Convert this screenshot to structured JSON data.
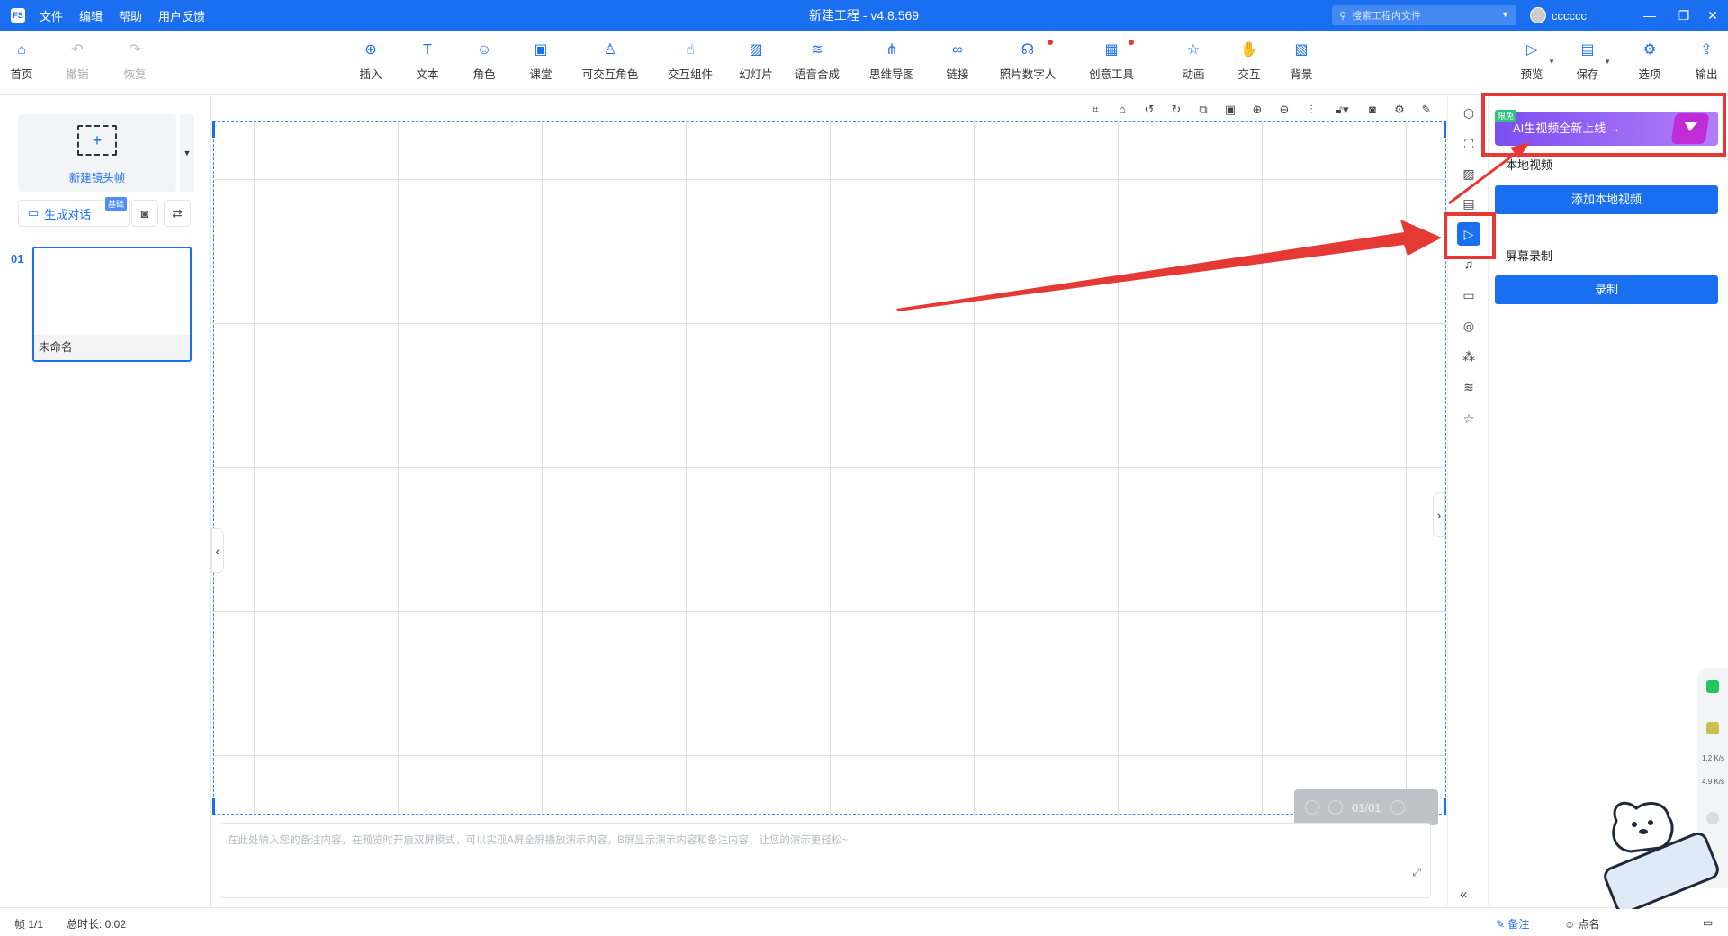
{
  "app": {
    "logo_text": "FS",
    "window_title": "新建工程 - v4.8.569",
    "menu": [
      "文件",
      "编辑",
      "帮助",
      "用户反馈"
    ],
    "search_placeholder": "搜索工程内文件",
    "username": "cccccc",
    "accent_color": "#1a6ff0"
  },
  "toolbar": {
    "home": "首页",
    "undo": "撤销",
    "redo": "恢复",
    "insert": "插入",
    "text": "文本",
    "role": "角色",
    "classroom": "课堂",
    "interactive_role": "可交互角色",
    "interactive_component": "交互组件",
    "slides": "幻灯片",
    "tts": "语音合成",
    "mindmap": "思维导图",
    "link": "链接",
    "photo_avatar": "照片数字人",
    "creative_tools": "创意工具",
    "animation": "动画",
    "interaction": "交互",
    "background": "背景",
    "preview": "预览",
    "save": "保存",
    "options": "选项",
    "export": "输出"
  },
  "left_panel": {
    "new_frame_label": "新建镜头帧",
    "generate_dialog": "生成对话",
    "generate_badge": "基础",
    "frames": [
      {
        "number": "01",
        "name": "未命名"
      }
    ]
  },
  "canvas": {
    "page_indicator": "01/01"
  },
  "notes": {
    "placeholder": "在此处输入您的备注内容，在预览时开启双屏模式，可以实现A屏全屏播放演示内容，B屏显示演示内容和备注内容，让您的演示更轻松~"
  },
  "right_panel": {
    "ai_banner_text": "AI生视频全新上线 →",
    "ai_banner_tag": "限免",
    "local_video_title": "本地视频",
    "add_local_video": "添加本地视频",
    "screen_record_title": "屏幕录制",
    "record_button": "录制"
  },
  "statusbar": {
    "frame_count": "帧 1/1",
    "total_duration": "总时长: 0:02",
    "notes_toggle": "备注",
    "roll_call": "点名"
  },
  "widget": {
    "upload_speed": "1.2 K/s",
    "download_speed": "4.9 K/s"
  }
}
